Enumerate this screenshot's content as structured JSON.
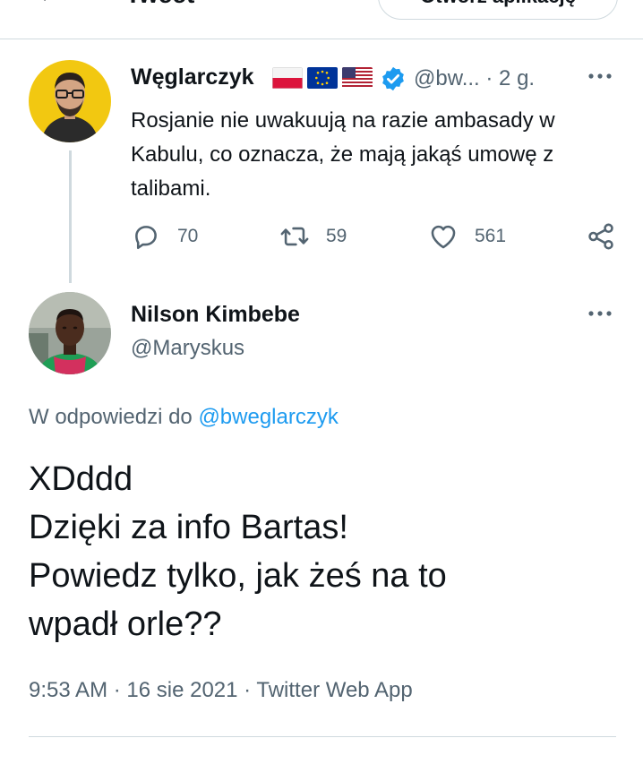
{
  "header": {
    "title": "Tweet",
    "open_app_label": "Otwórz aplikację"
  },
  "parent_tweet": {
    "author_name": "Węglarczyk",
    "flags": [
      "poland-flag-icon",
      "eu-flag-icon",
      "usa-flag-icon"
    ],
    "handle_time": "@bw... · 2 g.",
    "text": "Rosjanie nie uwakuują na razie ambasady w Kabulu, co oznacza, że mają jakąś umowę z talibami.",
    "replies": "70",
    "retweets": "59",
    "likes": "561",
    "accent_color": "#1d9bf0"
  },
  "reply_tweet": {
    "author_name": "Nilson Kimbebe",
    "handle": "@Maryskus",
    "reply_to_prefix": "W odpowiedzi do",
    "reply_to_mention": "@bweglarczyk",
    "lines": [
      "XDddd",
      "Dzięki za info Bartas!",
      "Powiedz tylko, jak żeś na to",
      "wpadł orle??"
    ],
    "meta": "9:53 AM · 16 sie 2021 · Twitter Web App"
  }
}
